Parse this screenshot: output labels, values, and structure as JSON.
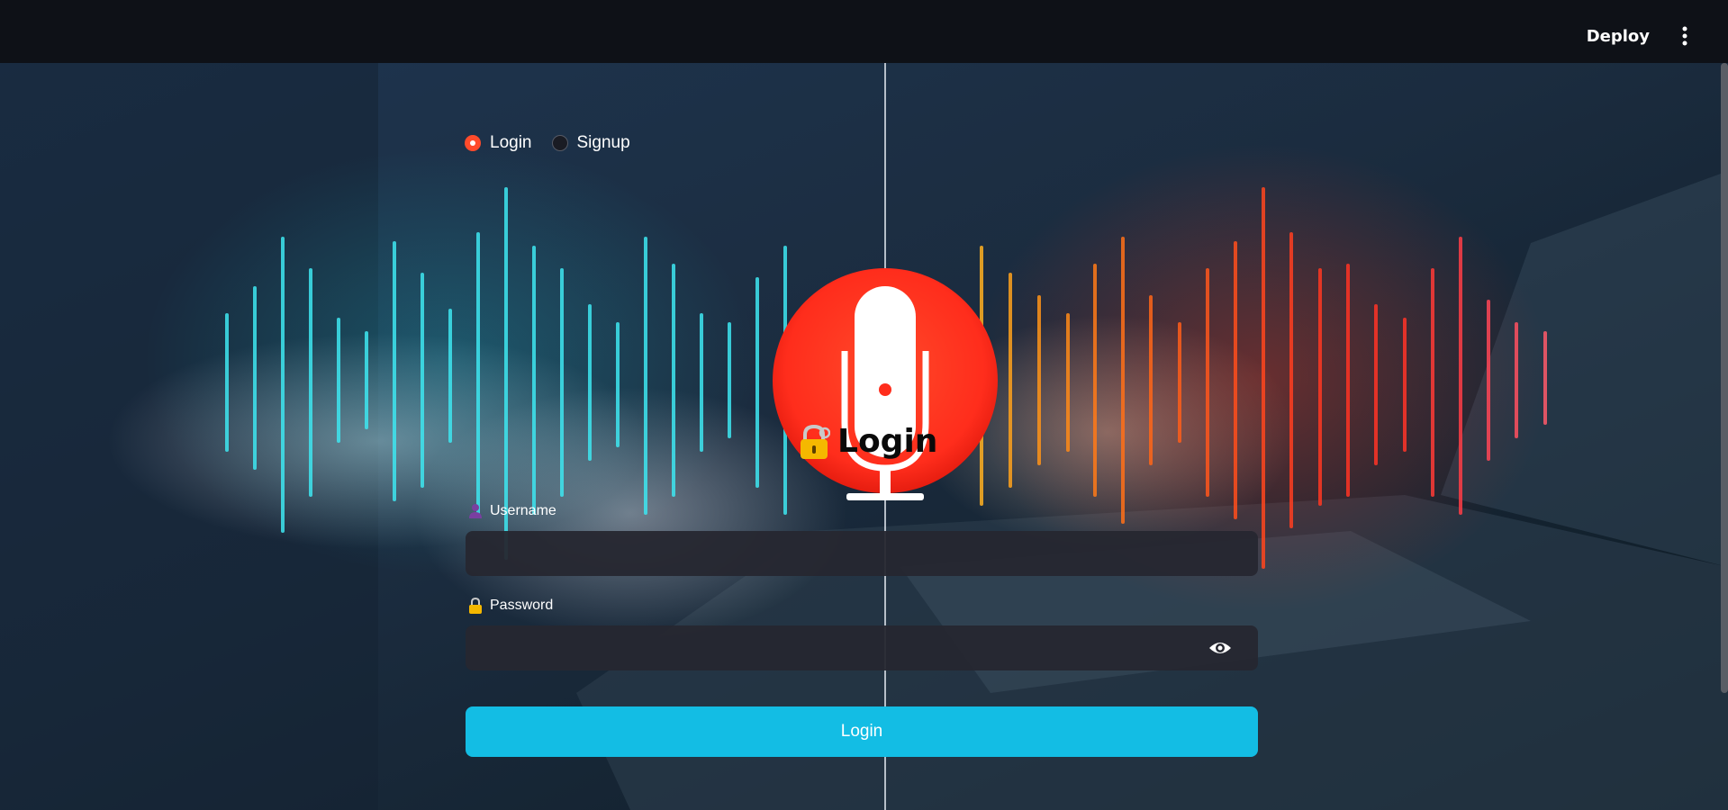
{
  "header": {
    "deploy_label": "Deploy",
    "menu_icon": "kebab-menu-icon"
  },
  "auth_mode": {
    "options": [
      {
        "label": "Login",
        "selected": true
      },
      {
        "label": "Signup",
        "selected": false
      }
    ]
  },
  "form": {
    "title": "Login",
    "title_icon": "lock-with-key-icon",
    "username": {
      "label": "Username",
      "icon": "user-silhouette-icon",
      "value": ""
    },
    "password": {
      "label": "Password",
      "icon": "lock-icon",
      "value": "",
      "toggle_icon": "eye-icon"
    },
    "submit_label": "Login"
  },
  "background": {
    "logo_icon": "microphone-icon"
  },
  "colors": {
    "accent": "#ff4b2b",
    "button": "#13bde4",
    "input_bg": "#262730",
    "header_bg": "#0e1117",
    "wave_left": "#3ee6f0",
    "wave_right": "#ff5a1f"
  }
}
